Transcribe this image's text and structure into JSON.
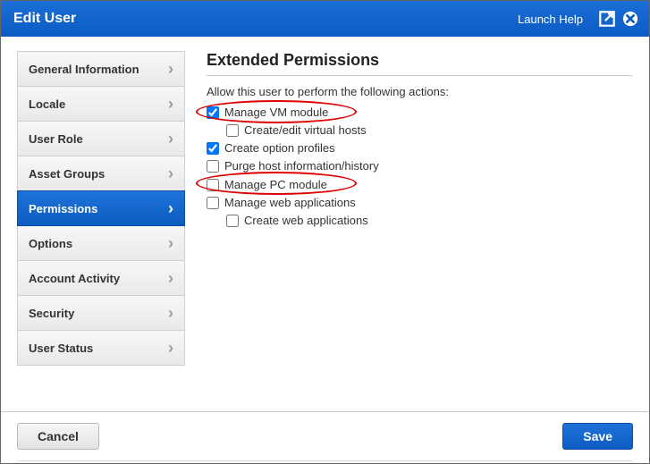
{
  "header": {
    "title": "Edit User",
    "help_label": "Launch Help"
  },
  "sidebar": {
    "items": [
      {
        "label": "General Information",
        "active": false
      },
      {
        "label": "Locale",
        "active": false
      },
      {
        "label": "User Role",
        "active": false
      },
      {
        "label": "Asset Groups",
        "active": false
      },
      {
        "label": "Permissions",
        "active": true
      },
      {
        "label": "Options",
        "active": false
      },
      {
        "label": "Account Activity",
        "active": false
      },
      {
        "label": "Security",
        "active": false
      },
      {
        "label": "User Status",
        "active": false
      }
    ]
  },
  "content": {
    "section_title": "Extended Permissions",
    "description": "Allow this user to perform the following actions:",
    "permissions": [
      {
        "label": "Manage VM module",
        "checked": true,
        "indent": 0
      },
      {
        "label": "Create/edit virtual hosts",
        "checked": false,
        "indent": 1
      },
      {
        "label": "Create option profiles",
        "checked": true,
        "indent": 0
      },
      {
        "label": "Purge host information/history",
        "checked": false,
        "indent": 0
      },
      {
        "label": "Manage PC module",
        "checked": false,
        "indent": 0
      },
      {
        "label": "Manage web applications",
        "checked": false,
        "indent": 0
      },
      {
        "label": "Create web applications",
        "checked": false,
        "indent": 1
      }
    ]
  },
  "footer": {
    "cancel_label": "Cancel",
    "save_label": "Save"
  }
}
